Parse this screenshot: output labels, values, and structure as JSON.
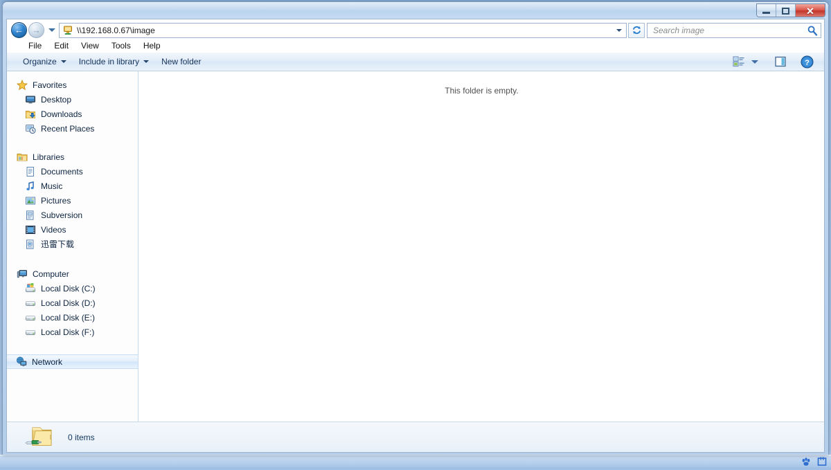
{
  "window": {
    "title_hidden": "",
    "controls": {
      "minimize": "Minimize",
      "maximize": "Maximize",
      "close": "Close"
    }
  },
  "address_bar": {
    "back_label": "Back",
    "forward_label": "Forward",
    "recent_pages_label": "Recent pages",
    "path": "\\\\192.168.0.67\\image",
    "path_icon": "network-computer-icon",
    "dropdown_label": "Previous locations",
    "refresh_label": "Refresh"
  },
  "search": {
    "placeholder": "Search image",
    "icon": "search-icon"
  },
  "menu": {
    "items": [
      {
        "label": "File"
      },
      {
        "label": "Edit"
      },
      {
        "label": "View"
      },
      {
        "label": "Tools"
      },
      {
        "label": "Help"
      }
    ]
  },
  "toolbar": {
    "organize_label": "Organize",
    "include_in_library_label": "Include in library",
    "new_folder_label": "New folder",
    "view_options_label": "Change your view",
    "preview_pane_label": "Show the preview pane",
    "help_label": "Get help"
  },
  "navigation": {
    "groups": [
      {
        "header": {
          "label": "Favorites",
          "icon": "favorites-star-icon"
        },
        "items": [
          {
            "label": "Desktop",
            "icon": "desktop-monitor-icon"
          },
          {
            "label": "Downloads",
            "icon": "downloads-folder-icon"
          },
          {
            "label": "Recent Places",
            "icon": "recent-places-icon"
          }
        ]
      },
      {
        "header": {
          "label": "Libraries",
          "icon": "libraries-folder-icon"
        },
        "items": [
          {
            "label": "Documents",
            "icon": "documents-library-icon"
          },
          {
            "label": "Music",
            "icon": "music-note-icon"
          },
          {
            "label": "Pictures",
            "icon": "pictures-library-icon"
          },
          {
            "label": "Subversion",
            "icon": "subversion-library-icon"
          },
          {
            "label": "Videos",
            "icon": "videos-library-icon"
          },
          {
            "label": "迅雷下载",
            "icon": "xunlei-download-library-icon"
          }
        ]
      },
      {
        "header": {
          "label": "Computer",
          "icon": "computer-icon"
        },
        "items": [
          {
            "label": "Local Disk (C:)",
            "icon": "system-drive-icon"
          },
          {
            "label": "Local Disk (D:)",
            "icon": "drive-icon"
          },
          {
            "label": "Local Disk (E:)",
            "icon": "drive-icon"
          },
          {
            "label": "Local Disk (F:)",
            "icon": "drive-icon"
          }
        ]
      }
    ],
    "network": {
      "label": "Network",
      "icon": "network-icon",
      "selected": true
    }
  },
  "content": {
    "empty_message": "This folder is empty."
  },
  "status_bar": {
    "item_count": "0 items",
    "folder_icon": "network-folder-icon"
  },
  "taskbar": {
    "tray_icons": [
      {
        "name": "baidu-paw-icon"
      },
      {
        "name": "input-method-icon"
      }
    ]
  },
  "colors": {
    "accent": "#2f84d0",
    "close_red": "#c1352a",
    "frame_blue": "#b3cdea",
    "text_dark": "#0c2340"
  }
}
